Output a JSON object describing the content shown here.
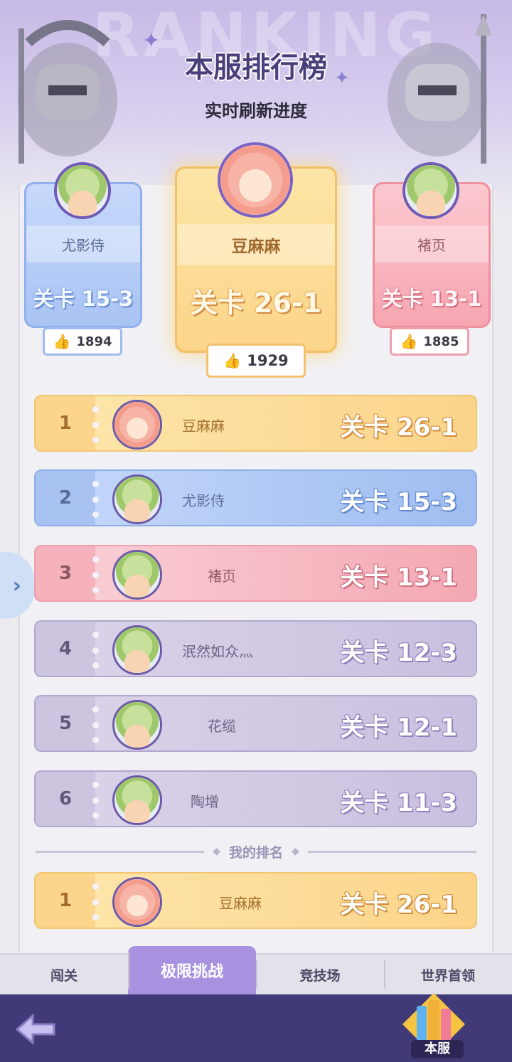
{
  "header": {
    "watermark": "RANKING",
    "title": "本服排行榜",
    "subtitle": "实时刷新进度"
  },
  "podium": [
    {
      "place": 2,
      "name": "尤影侍",
      "stage": "关卡 15-3",
      "likes": "1894",
      "color": "#a9c3f4"
    },
    {
      "place": 1,
      "name": "豆麻麻",
      "stage": "关卡 26-1",
      "likes": "1929",
      "color": "#fbd58a"
    },
    {
      "place": 3,
      "name": "褚页",
      "stage": "关卡 13-1",
      "likes": "1885",
      "color": "#f6a6b1"
    }
  ],
  "ranking": [
    {
      "rank": "1",
      "name": "豆麻麻",
      "stage": "关卡 26-1"
    },
    {
      "rank": "2",
      "name": "尤影侍",
      "stage": "关卡 15-3"
    },
    {
      "rank": "3",
      "name": "褚页",
      "stage": "关卡 13-1"
    },
    {
      "rank": "4",
      "name": "泯然如众灬",
      "stage": "关卡 12-3"
    },
    {
      "rank": "5",
      "name": "花缆",
      "stage": "关卡 12-1"
    },
    {
      "rank": "6",
      "name": "陶增",
      "stage": "关卡 11-3"
    }
  ],
  "my_rank": {
    "divider_label": "我的排名",
    "rank": "1",
    "name": "豆麻麻",
    "stage": "关卡 26-1"
  },
  "side_tab": {
    "icon": "chevron-right-icon",
    "glyph": "›"
  },
  "tabs": [
    {
      "label": "闯关"
    },
    {
      "label": "极限挑战",
      "active": true
    },
    {
      "label": "竞技场"
    },
    {
      "label": "世界首领"
    }
  ],
  "bottom": {
    "back_icon": "back-arrow-icon",
    "server_label": "本服"
  },
  "icons": {
    "thumb": "👍"
  }
}
